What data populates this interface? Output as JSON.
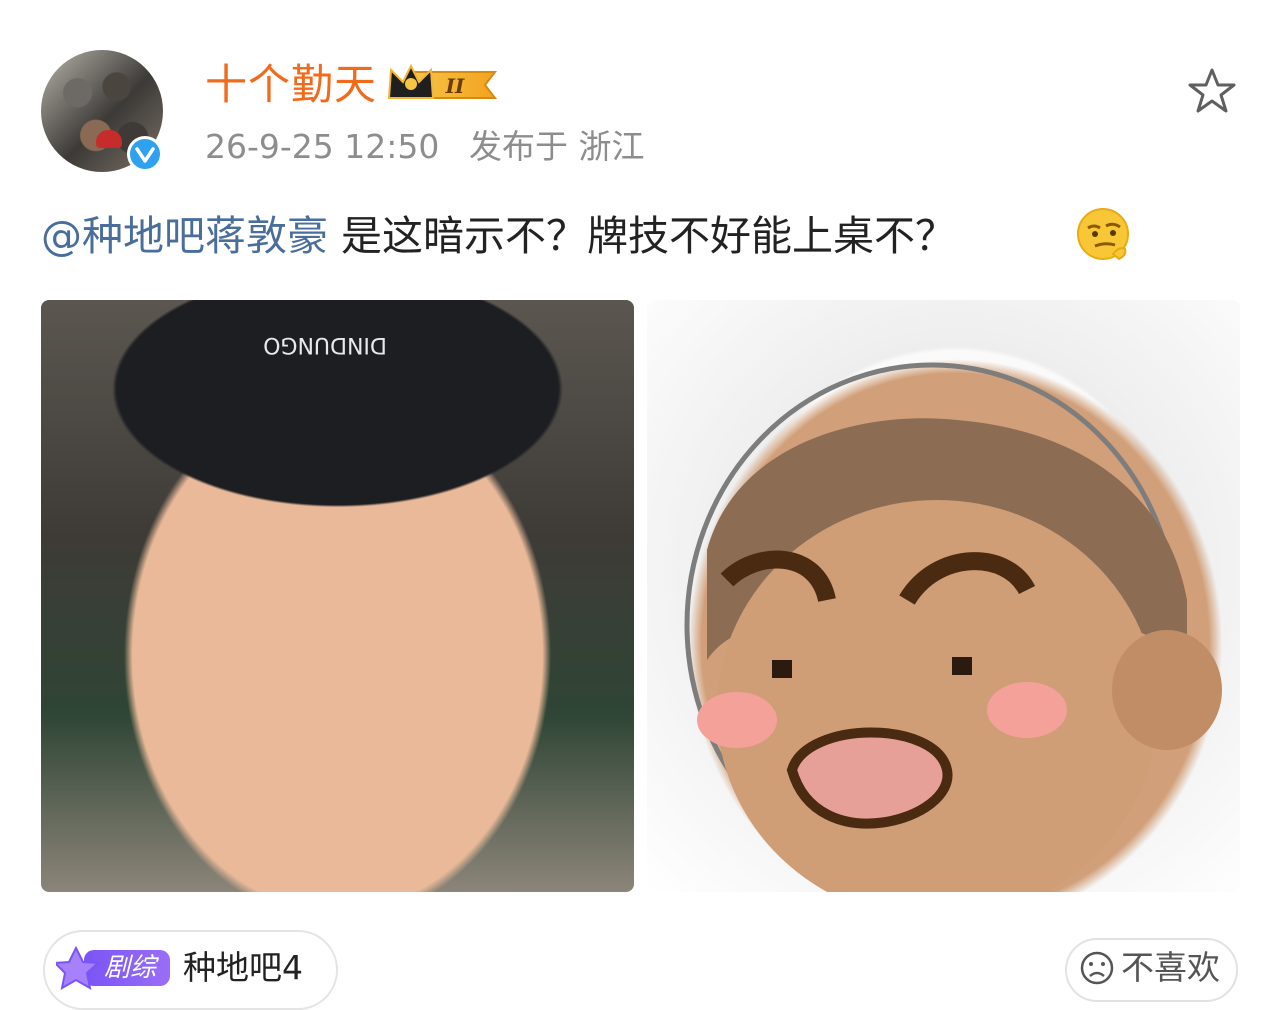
{
  "post": {
    "author": "十个勤天",
    "vip_level": "II",
    "timestamp": "26-9-25 12:50",
    "location": "发布于 浙江",
    "mention": "@种地吧蒋敦豪",
    "text": " 是这暗示不？牌技不好能上桌不？",
    "emoji": "thinking-emoji",
    "cap_text": "DINDUNGO"
  },
  "tag": {
    "badge": "剧综",
    "label": "种地吧4"
  },
  "actions": {
    "dislike_label": "不喜欢"
  },
  "colors": {
    "username": "#f06b1c",
    "mention": "#4a6e9b",
    "verified": "#2ea1ef",
    "badge": "#8a5cf6"
  },
  "icons": [
    "verified-icon",
    "crown-icon",
    "star-icon",
    "thinking-emoji",
    "frown-face-icon"
  ]
}
